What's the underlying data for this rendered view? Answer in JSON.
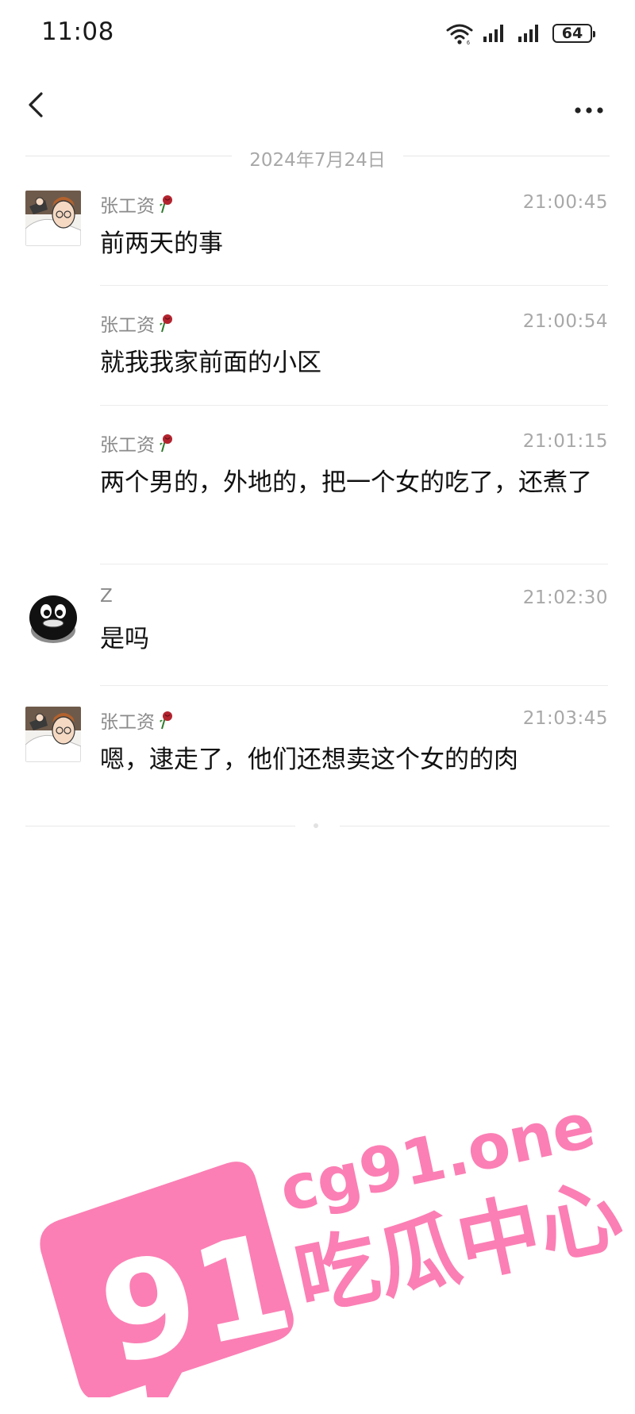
{
  "status_bar": {
    "time": "11:08",
    "battery": "64"
  },
  "nav": {
    "back_icon": "chevron-left-icon",
    "more_icon": "more-dots-icon"
  },
  "date_divider": "2024年7月24日",
  "messages": [
    {
      "sender": "张工资",
      "time": "21:00:45",
      "text": "前两天的事"
    },
    {
      "sender": "张工资",
      "time": "21:00:54",
      "text": "就我我家前面的小区"
    },
    {
      "sender": "张工资",
      "time": "21:01:15",
      "text": "两个男的，外地的，把一个女的吃了，还煮了"
    },
    {
      "sender": "Z",
      "time": "21:02:30",
      "text": "是吗"
    },
    {
      "sender": "张工资",
      "time": "21:03:45",
      "text": "嗯，逮走了，他们还想卖这个女的的肉"
    }
  ],
  "watermark": {
    "logo_number": "91",
    "site": "cg91.one",
    "name": "吃瓜中心",
    "color": "#fb7fb4"
  }
}
